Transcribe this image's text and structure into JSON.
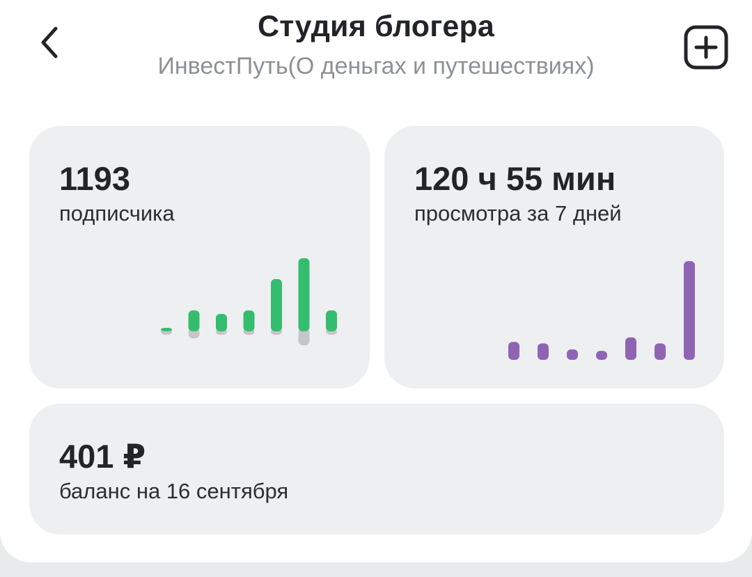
{
  "header": {
    "title": "Студия блогера",
    "subtitle": "ИнвестПуть(О деньгах и путешествиях)",
    "back_icon": "chevron-left-icon",
    "add_icon": "plus-square-icon"
  },
  "cards": {
    "subscribers": {
      "value": "1193",
      "label": "подписчика"
    },
    "views": {
      "value": "120 ч 55 мин",
      "label": "просмотра за 7 дней"
    },
    "balance": {
      "value": "401 ₽",
      "label": "баланс на 16 сентября"
    }
  },
  "colors": {
    "subscribers_gain": "#35bd6f",
    "subscribers_loss": "#c4c6c9",
    "views_bar": "#8f64b3",
    "card_bg": "#eeeff1",
    "text_primary": "#222428",
    "text_secondary": "#8d9095"
  },
  "chart_data": [
    {
      "type": "bar",
      "name": "subscribers",
      "categories": [
        "1",
        "2",
        "3",
        "4",
        "5",
        "6",
        "7"
      ],
      "series": [
        {
          "values": [
            1,
            6,
            5,
            6,
            15,
            21,
            6
          ]
        },
        {
          "values": [
            -1,
            -2,
            -1,
            -1,
            -1,
            -4,
            -1
          ]
        }
      ]
    },
    {
      "type": "bar",
      "name": "views",
      "categories": [
        "1",
        "2",
        "3",
        "4",
        "5",
        "6",
        "7"
      ],
      "series": [
        {
          "values": [
            6,
            5.5,
            3.5,
            3,
            7.5,
            5.5,
            33
          ]
        }
      ]
    }
  ]
}
